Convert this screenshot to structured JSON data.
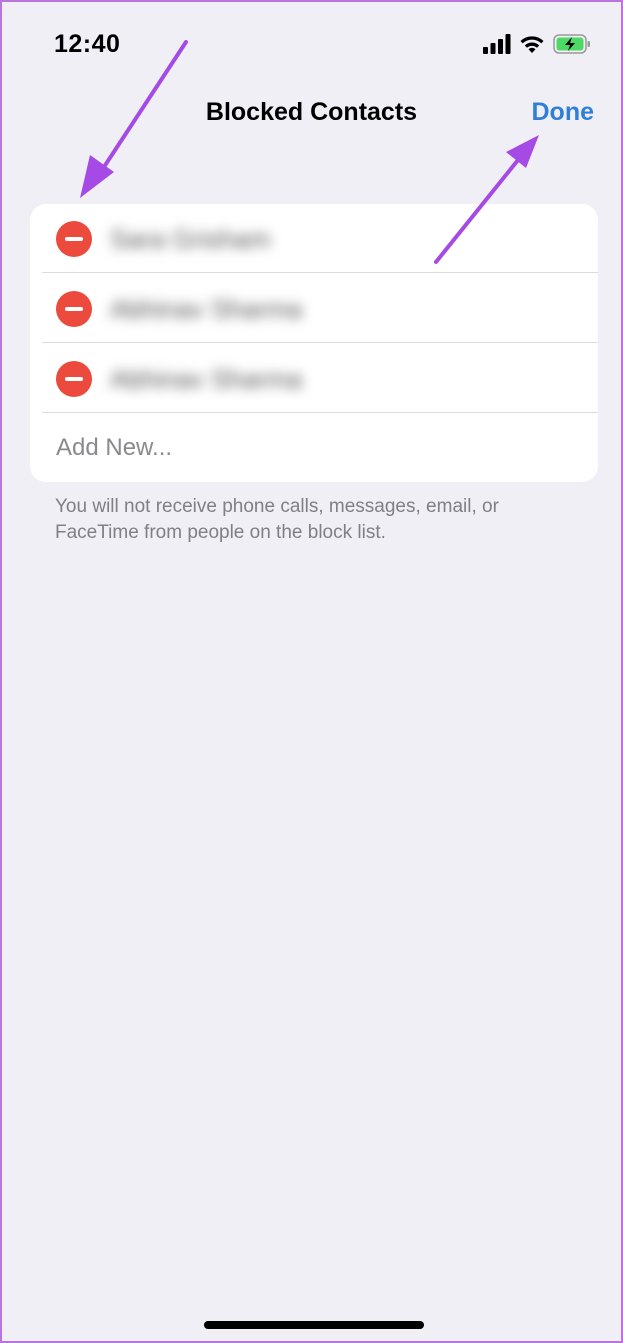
{
  "status_bar": {
    "time": "12:40",
    "icons": [
      "signal-icon",
      "wifi-icon",
      "battery-charging-icon"
    ]
  },
  "nav": {
    "title": "Blocked Contacts",
    "done_label": "Done"
  },
  "blocked_list": {
    "contacts": [
      {
        "name": "Sara Grisham"
      },
      {
        "name": "Abhinav Sharma"
      },
      {
        "name": "Abhinav Sharma"
      }
    ],
    "add_new_label": "Add New..."
  },
  "footer_note": "You will not receive phone calls, messages, email, or FaceTime from people on the block list.",
  "colors": {
    "accent": "#2f7fd8",
    "delete": "#eb4a3c",
    "annotation_arrow": "#a64ae6",
    "background": "#f0eff5"
  },
  "annotations": [
    "arrow-to-delete-button",
    "arrow-to-done-button"
  ]
}
